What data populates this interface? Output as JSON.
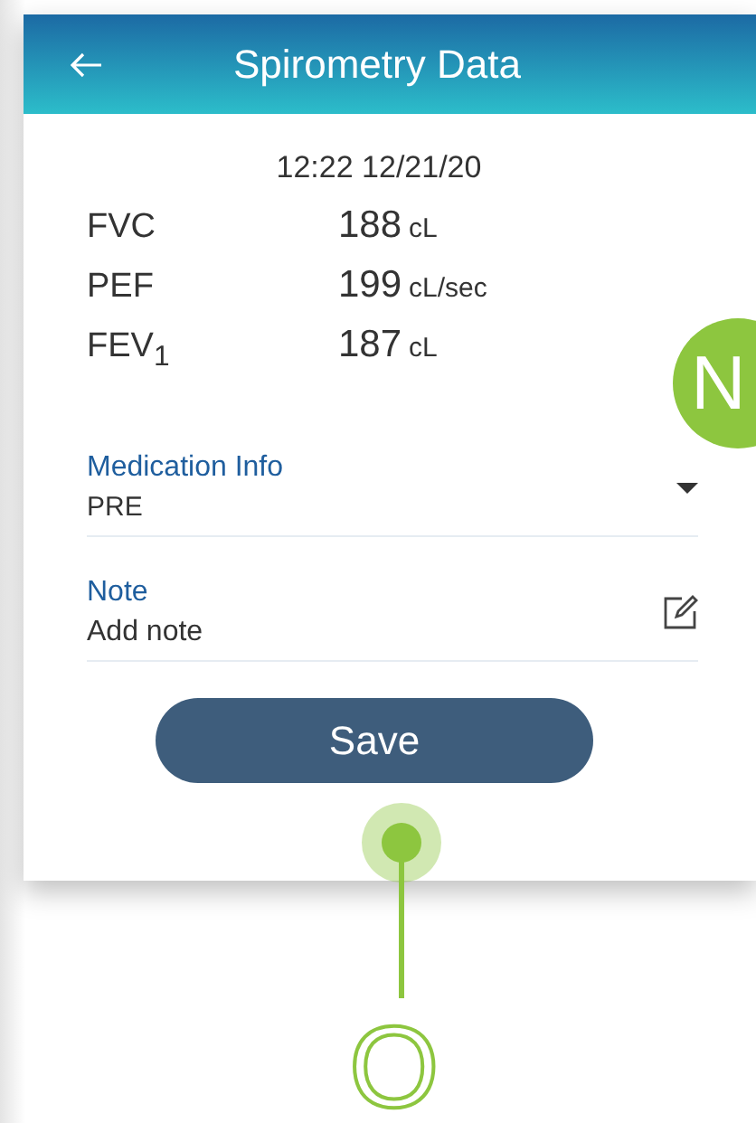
{
  "header": {
    "title": "Spirometry Data"
  },
  "timestamp": "12:22 12/21/20",
  "measurements": [
    {
      "name": "FVC",
      "value": "188",
      "unit": "cL"
    },
    {
      "name": "PEF",
      "value": "199",
      "unit": "cL/sec"
    },
    {
      "name": "FEV$_{1}$",
      "value": "187",
      "unit": "cL"
    }
  ],
  "fields": [
    {
      "kind": "dropdown",
      "label": "Medication Info",
      "value": "PRE"
    },
    {
      "kind": "note",
      "label": "Note",
      "placeholder": "Add note"
    }
  ],
  "save_button": {
    "label": "Save"
  },
  "callouts": [
    {
      "kind": "circle",
      "label": "N"
    },
    {
      "kind": "pin",
      "label": "O"
    }
  ]
}
